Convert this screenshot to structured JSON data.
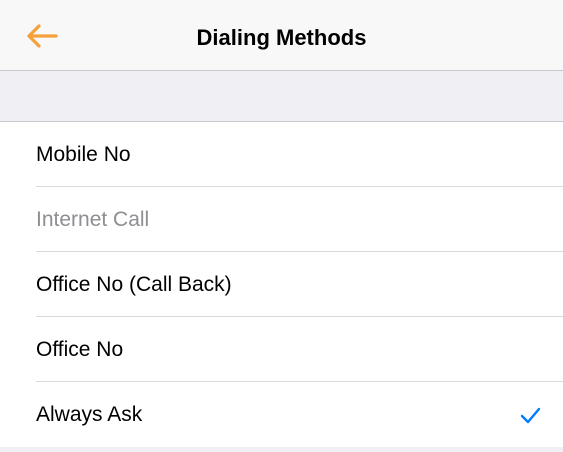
{
  "navbar": {
    "title": "Dialing Methods",
    "back_icon": "arrow-left-icon",
    "accent_color": "#f5a03a"
  },
  "options": [
    {
      "label": "Mobile No",
      "enabled": true,
      "selected": false
    },
    {
      "label": "Internet Call",
      "enabled": false,
      "selected": false
    },
    {
      "label": "Office No (Call Back)",
      "enabled": true,
      "selected": false
    },
    {
      "label": "Office No",
      "enabled": true,
      "selected": false
    },
    {
      "label": "Always Ask",
      "enabled": true,
      "selected": true
    }
  ],
  "checkmark_icon": "checkmark-icon",
  "checkmark_color": "#007aff"
}
